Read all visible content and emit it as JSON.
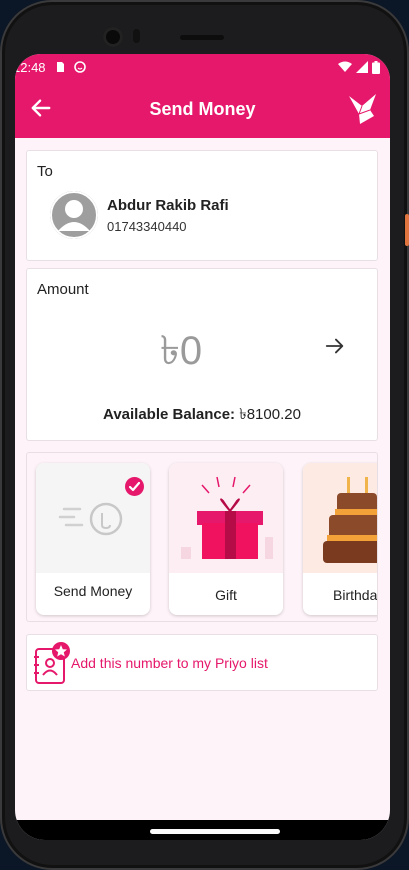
{
  "status_bar": {
    "time": "12:48"
  },
  "app_bar": {
    "title": "Send Money",
    "back_icon": "arrow-left-icon",
    "logo_icon": "paper-bird-logo-icon"
  },
  "to_section": {
    "label": "To",
    "contact_name": "Abdur Rakib Rafi",
    "contact_number": "01743340440"
  },
  "amount_section": {
    "label": "Amount",
    "amount_value": "৳0",
    "balance_label": "Available Balance:",
    "balance_value": "৳8100.20"
  },
  "transfer_types": [
    {
      "label": "Send Money",
      "selected": true
    },
    {
      "label": "Gift",
      "selected": false
    },
    {
      "label": "Birthda",
      "selected": false
    }
  ],
  "priyo": {
    "label": "Add this number to my Priyo list"
  },
  "colors": {
    "brand": "#e5186b",
    "background": "#fdf3f8"
  }
}
